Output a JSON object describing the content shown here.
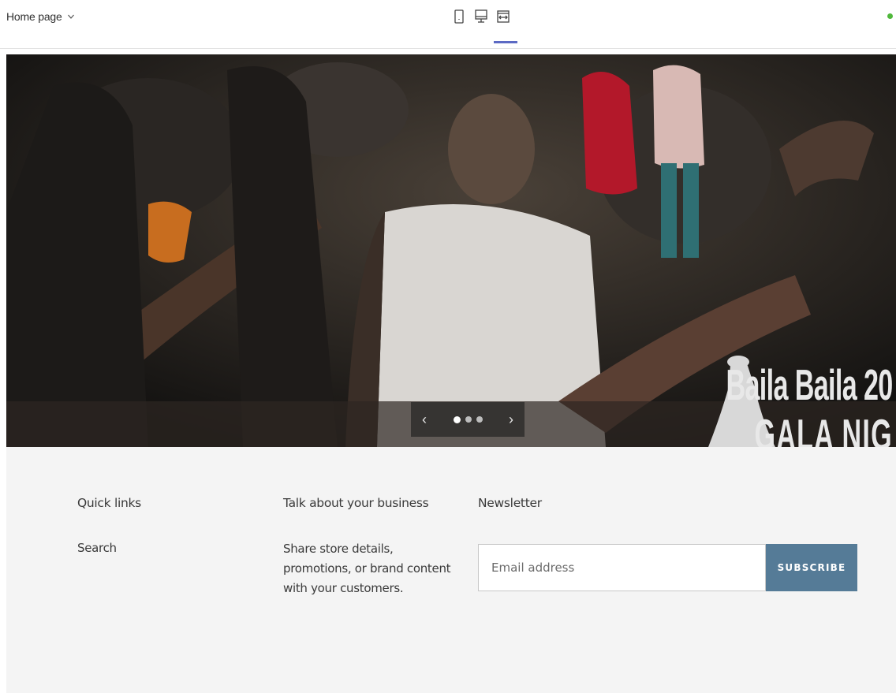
{
  "topbar": {
    "page_label": "Home page",
    "icons": [
      "chevron-down-icon",
      "mobile-view-icon",
      "desktop-view-icon",
      "full-width-view-icon"
    ],
    "active_view": "full-width",
    "status_color": "#50b83c",
    "accent_color": "#5c6ac4"
  },
  "hero": {
    "brand_line1": "Baila Baila 20",
    "brand_line2": "GALA NIG",
    "prev_label": "‹",
    "next_label": "›",
    "dot_count": 3,
    "active_dot": 1
  },
  "footer": {
    "quick_links": {
      "heading": "Quick links",
      "items": [
        "Search"
      ]
    },
    "business": {
      "heading": "Talk about your business",
      "text": "Share store details, promotions, or brand content with your customers."
    },
    "newsletter": {
      "heading": "Newsletter",
      "placeholder": "Email address",
      "button_label": "SUBSCRIBE",
      "button_color": "#557b97"
    }
  }
}
